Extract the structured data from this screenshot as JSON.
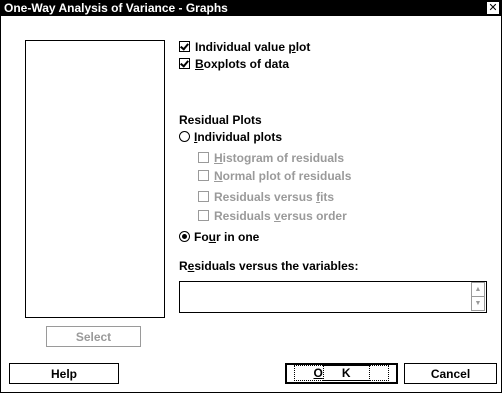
{
  "window": {
    "title": "One-Way Analysis of Variance - Graphs",
    "close_glyph": "✕"
  },
  "options": {
    "individual_value_plot": {
      "label_before": "Individual value ",
      "mnemonic": "p",
      "label_after": "lot",
      "checked": true
    },
    "boxplots": {
      "label_before": "",
      "mnemonic": "B",
      "label_after": "oxplots of data",
      "checked": true
    }
  },
  "residual_plots": {
    "heading": "Residual Plots",
    "individual_plots": {
      "label_before": "",
      "mnemonic": "I",
      "label_after": "ndividual plots",
      "selected": false
    },
    "histogram": {
      "label_before": "",
      "mnemonic": "H",
      "label_after": "istogram of residuals",
      "checked": false,
      "enabled": false
    },
    "normal_plot": {
      "label_before": "",
      "mnemonic": "N",
      "label_after": "ormal plot of residuals",
      "checked": false,
      "enabled": false
    },
    "versus_fits": {
      "label_before": "Residuals versus ",
      "mnemonic": "f",
      "label_after": "its",
      "checked": false,
      "enabled": false
    },
    "versus_order": {
      "label_before": "Residuals ",
      "mnemonic": "v",
      "label_after": "ersus order",
      "checked": false,
      "enabled": false
    },
    "four_in_one": {
      "label_before": "Fo",
      "mnemonic": "u",
      "label_after": "r in one",
      "selected": true
    }
  },
  "variables": {
    "label_before": "R",
    "mnemonic": "e",
    "label_after": "siduals versus the variables:",
    "value": ""
  },
  "buttons": {
    "select": "Select",
    "help": "Help",
    "ok_mnemonic": "O",
    "ok_rest": "K",
    "cancel": "Cancel"
  }
}
